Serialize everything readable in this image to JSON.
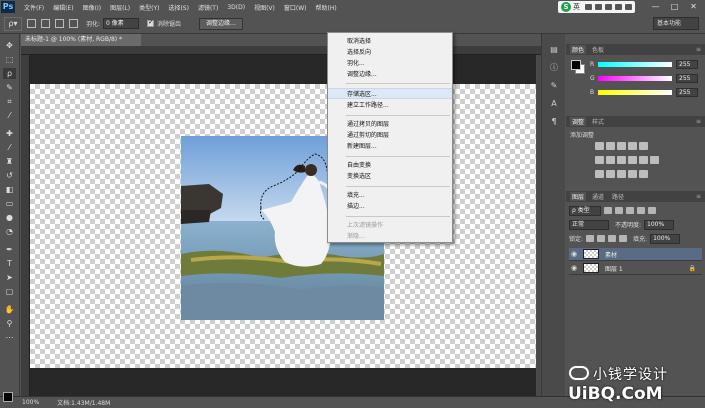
{
  "app": {
    "logo": "Ps"
  },
  "menu": [
    "文件(F)",
    "编辑(E)",
    "图像(I)",
    "图层(L)",
    "类型(Y)",
    "选择(S)",
    "滤镜(T)",
    "3D(D)",
    "视图(V)",
    "窗口(W)",
    "帮助(H)"
  ],
  "tray": {
    "ime_logo": "S",
    "ime_text": "英"
  },
  "window_controls": {
    "minimize": "—",
    "restore": "□",
    "close": "✕"
  },
  "options": {
    "feather_label": "羽化:",
    "feather_value": "0 像素",
    "antialias_label": "消除锯齿",
    "refine_button": "调整边缘...",
    "workspace": "基本功能"
  },
  "document": {
    "tab_title": "未标题-1 @ 100% (素材, RGB/8) *",
    "zoom": "100%",
    "doc_size": "文档:1.43M/1.48M"
  },
  "context_menu": {
    "group1": [
      {
        "label": "取消选择",
        "disabled": false
      },
      {
        "label": "选择反向",
        "disabled": false
      },
      {
        "label": "羽化...",
        "disabled": false
      },
      {
        "label": "调整边缘...",
        "disabled": false
      }
    ],
    "group2": [
      {
        "label": "存储选区...",
        "disabled": false,
        "highlight": true
      },
      {
        "label": "建立工作路径...",
        "disabled": false
      }
    ],
    "group3": [
      {
        "label": "通过拷贝的图层",
        "disabled": false
      },
      {
        "label": "通过剪切的图层",
        "disabled": false
      },
      {
        "label": "新建图层...",
        "disabled": false
      }
    ],
    "group4": [
      {
        "label": "自由变换",
        "disabled": false
      },
      {
        "label": "变换选区",
        "disabled": false
      }
    ],
    "group5": [
      {
        "label": "填充...",
        "disabled": false
      },
      {
        "label": "描边...",
        "disabled": false
      }
    ],
    "group6": [
      {
        "label": "上次滤镜操作",
        "disabled": true
      },
      {
        "label": "渐隐...",
        "disabled": true
      }
    ]
  },
  "color_panel": {
    "tabs": [
      "颜色",
      "色板"
    ],
    "channels": [
      {
        "label": "R",
        "value": "255"
      },
      {
        "label": "G",
        "value": "255"
      },
      {
        "label": "B",
        "value": "255"
      }
    ]
  },
  "adjustments_panel": {
    "tabs": [
      "调整",
      "样式"
    ],
    "title": "添加调整"
  },
  "layers_panel": {
    "tabs": [
      "图层",
      "通道",
      "路径"
    ],
    "kind_filter": "ρ 类型",
    "blend_mode": "正常",
    "opacity_label": "不透明度:",
    "opacity_value": "100%",
    "lock_label": "锁定:",
    "fill_label": "填充:",
    "fill_value": "100%",
    "layers": [
      {
        "name": "素材",
        "active": true,
        "locked": false
      },
      {
        "name": "图层 1",
        "active": false,
        "locked": true
      }
    ]
  },
  "watermark": {
    "line1": "小钱学设计",
    "line2": "UiBQ.CoM"
  },
  "colors": {
    "ui_bg": "#535353",
    "canvas_bg": "#282828",
    "menu_highlight": "#dde8f6",
    "active_layer": "#5a6b85"
  }
}
